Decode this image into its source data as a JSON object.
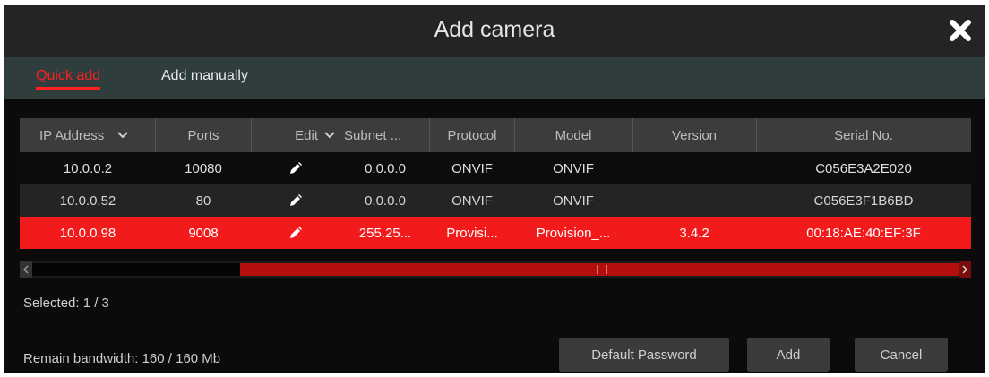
{
  "dialog": {
    "title": "Add camera"
  },
  "tabs": [
    {
      "label": "Quick add",
      "active": true
    },
    {
      "label": "Add manually",
      "active": false
    }
  ],
  "table": {
    "headers": {
      "ip": "IP Address",
      "ports": "Ports",
      "edit": "Edit",
      "subnet": "Subnet ...",
      "protocol": "Protocol",
      "model": "Model",
      "version": "Version",
      "serial": "Serial No."
    },
    "rows": [
      {
        "ip": "10.0.0.2",
        "ports": "10080",
        "subnet": "0.0.0.0",
        "protocol": "ONVIF",
        "model": "ONVIF",
        "version": "",
        "serial": "C056E3A2E020",
        "selected": false
      },
      {
        "ip": "10.0.0.52",
        "ports": "80",
        "subnet": "0.0.0.0",
        "protocol": "ONVIF",
        "model": "ONVIF",
        "version": "",
        "serial": "C056E3F1B6BD",
        "selected": false
      },
      {
        "ip": "10.0.0.98",
        "ports": "9008",
        "subnet": "255.25...",
        "protocol": "Provisi...",
        "model": "Provision_...",
        "version": "3.4.2",
        "serial": "00:18:AE:40:EF:3F",
        "selected": true
      }
    ]
  },
  "status": {
    "selected": "Selected: 1 / 3",
    "bandwidth": "Remain bandwidth: 160 / 160 Mb"
  },
  "buttons": {
    "default_password": "Default Password",
    "add": "Add",
    "cancel": "Cancel"
  },
  "colors": {
    "accent_red": "#f21a1a",
    "title_bar": "#242424",
    "tab_bar": "#2f3d3d",
    "button": "#3b3b3b"
  },
  "icons": {
    "close": "close-icon",
    "edit": "pencil-icon",
    "dropdown": "chevron-down-icon"
  }
}
